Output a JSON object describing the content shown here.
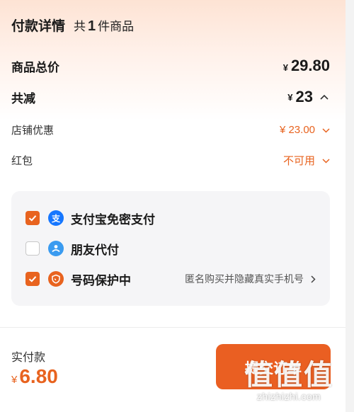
{
  "header": {
    "title": "付款详情",
    "count_prefix": "共",
    "count_value": "1",
    "count_suffix": "件商品"
  },
  "summary": {
    "goods_total_label": "商品总价",
    "goods_total_currency": "¥",
    "goods_total_value": "29.80",
    "discount_total_label": "共减",
    "discount_total_currency": "¥",
    "discount_total_value": "23",
    "discount_expand_icon": "chevron-up-icon"
  },
  "discounts": [
    {
      "label": "店铺优惠",
      "value": "¥ 23.00",
      "icon": "chevron-down-icon"
    },
    {
      "label": "红包",
      "value": "不可用",
      "icon": "chevron-down-icon"
    }
  ],
  "payment_options": [
    {
      "label": "支付宝免密支付",
      "checked": true,
      "icon": "alipay-icon",
      "icon_glyph": "支",
      "icon_color": "#1677ff"
    },
    {
      "label": "朋友代付",
      "checked": false,
      "icon": "friend-pay-icon",
      "icon_glyph": "",
      "icon_color": "#3a9bf0"
    },
    {
      "label": "号码保护中",
      "checked": true,
      "icon": "shield-icon",
      "icon_glyph": "",
      "icon_color": "#e8631f",
      "note": "匿名购买并隐藏真实手机号"
    }
  ],
  "footer": {
    "paid_label": "实付款",
    "paid_currency": "¥",
    "paid_value": "6.80",
    "submit_label": "提交订单"
  },
  "watermark": {
    "mark": "值值值",
    "url": "zhizhizhi.com"
  },
  "colors": {
    "accent": "#e8631f",
    "button": "#ea5f22",
    "panel": "#f5f5f7"
  }
}
